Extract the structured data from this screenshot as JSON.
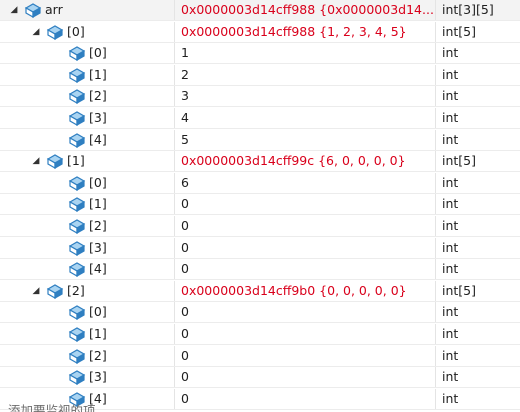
{
  "watch_rows": [
    {
      "name": "arr",
      "value": "0x0000003d14cff988 {0x0000003d14...",
      "type": "int[3][5]",
      "changed": true,
      "level": 0,
      "expanded": true
    },
    {
      "name": "[0]",
      "value": "0x0000003d14cff988 {1, 2, 3, 4, 5}",
      "type": "int[5]",
      "changed": true,
      "level": 1,
      "expanded": true
    },
    {
      "name": "[0]",
      "value": "1",
      "type": "int",
      "changed": false,
      "level": 2
    },
    {
      "name": "[1]",
      "value": "2",
      "type": "int",
      "changed": false,
      "level": 2
    },
    {
      "name": "[2]",
      "value": "3",
      "type": "int",
      "changed": false,
      "level": 2
    },
    {
      "name": "[3]",
      "value": "4",
      "type": "int",
      "changed": false,
      "level": 2
    },
    {
      "name": "[4]",
      "value": "5",
      "type": "int",
      "changed": false,
      "level": 2
    },
    {
      "name": "[1]",
      "value": "0x0000003d14cff99c {6, 0, 0, 0, 0}",
      "type": "int[5]",
      "changed": true,
      "level": 1,
      "expanded": true
    },
    {
      "name": "[0]",
      "value": "6",
      "type": "int",
      "changed": false,
      "level": 2
    },
    {
      "name": "[1]",
      "value": "0",
      "type": "int",
      "changed": false,
      "level": 2
    },
    {
      "name": "[2]",
      "value": "0",
      "type": "int",
      "changed": false,
      "level": 2
    },
    {
      "name": "[3]",
      "value": "0",
      "type": "int",
      "changed": false,
      "level": 2
    },
    {
      "name": "[4]",
      "value": "0",
      "type": "int",
      "changed": false,
      "level": 2
    },
    {
      "name": "[2]",
      "value": "0x0000003d14cff9b0 {0, 0, 0, 0, 0}",
      "type": "int[5]",
      "changed": true,
      "level": 1,
      "expanded": true
    },
    {
      "name": "[0]",
      "value": "0",
      "type": "int",
      "changed": false,
      "level": 2
    },
    {
      "name": "[1]",
      "value": "0",
      "type": "int",
      "changed": false,
      "level": 2
    },
    {
      "name": "[2]",
      "value": "0",
      "type": "int",
      "changed": false,
      "level": 2
    },
    {
      "name": "[3]",
      "value": "0",
      "type": "int",
      "changed": false,
      "level": 2
    },
    {
      "name": "[4]",
      "value": "0",
      "type": "int",
      "changed": false,
      "level": 2
    }
  ],
  "add_watch_placeholder": "添加要监视的项",
  "colors": {
    "changed_value": "#d9001b",
    "icon_blue": "#2f7fc1",
    "icon_light": "#a9d4f2"
  },
  "icons": {
    "expand": "caret-expanded-icon",
    "item": "object-cube-icon"
  }
}
